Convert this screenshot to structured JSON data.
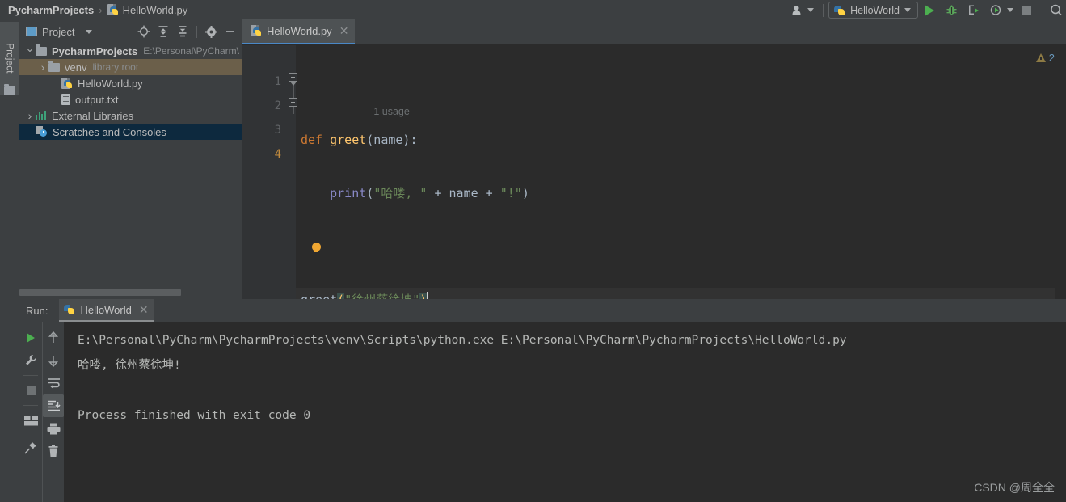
{
  "breadcrumb": {
    "project": "PycharmProjects",
    "separator": "›",
    "file": "HelloWorld.py",
    "file_icon": "python-file-icon"
  },
  "titlebar_right": {
    "profile_icon": "user-profile-icon",
    "run_config_name": "HelloWorld",
    "run_config_icon": "python-icon",
    "run_icon": "run-triangle-icon",
    "debug_icon": "debug-bug-icon",
    "coverage_icon": "run-with-coverage-icon",
    "profile_icon2": "profile-icon",
    "stop_icon": "stop-square-icon",
    "search_icon": "search-icon"
  },
  "left_strip": {
    "vertical_tab_label": "Project",
    "folder_icon": "folder-icon"
  },
  "project_panel": {
    "title": "Project",
    "title_icon": "project-window-icon",
    "dropdown_icon": "chevron-down-icon",
    "toolbar_icons": [
      "locate-target-icon",
      "expand-all-icon",
      "collapse-all-icon",
      "settings-gear-icon",
      "hide-minimize-icon"
    ],
    "tree": [
      {
        "label": "PycharmProjects",
        "sublabel": "E:\\Personal\\PyCharm\\",
        "icon": "folder-icon",
        "arrow": "expanded",
        "indent": 0,
        "state": "normal",
        "bold": true
      },
      {
        "label": "venv",
        "sublabel": "library root",
        "icon": "folder-icon",
        "arrow": "collapsed",
        "indent": 1,
        "state": "highlight-venv",
        "bold": false
      },
      {
        "label": "HelloWorld.py",
        "sublabel": "",
        "icon": "python-file-icon",
        "arrow": "none",
        "indent": 2,
        "state": "normal",
        "bold": false
      },
      {
        "label": "output.txt",
        "sublabel": "",
        "icon": "text-file-icon",
        "arrow": "none",
        "indent": 2,
        "state": "normal",
        "bold": false
      },
      {
        "label": "External Libraries",
        "sublabel": "",
        "icon": "library-icon",
        "arrow": "collapsed",
        "indent": 0,
        "state": "normal",
        "bold": false
      },
      {
        "label": "Scratches and Consoles",
        "sublabel": "",
        "icon": "scratches-icon",
        "arrow": "none",
        "indent": 0,
        "state": "selected",
        "bold": false
      }
    ]
  },
  "editor": {
    "tab_label": "HelloWorld.py",
    "tab_icon": "python-file-icon",
    "tab_close_icon": "close-icon",
    "inlay_hint": "1 usage",
    "warning_count": "2",
    "warning_icon": "warning-triangle-icon",
    "line_numbers": [
      "1",
      "2",
      "3",
      "4"
    ],
    "current_line": 4,
    "intention_bulb_icon": "lightbulb-icon",
    "code": {
      "line1_kw": "def",
      "line1_fn": "greet",
      "line1_rest": "(name):",
      "line2_fn": "print",
      "line2_open": "(",
      "line2_str1": "\"哈喽, \"",
      "line2_plus1": " + ",
      "line2_name": "name",
      "line2_plus2": " + ",
      "line2_str2": "\"!\"",
      "line2_close": ")",
      "line4_fn": "greet",
      "line4_open": "(",
      "line4_str": "\"徐州蔡徐坤\"",
      "line4_close": ")"
    }
  },
  "run_panel": {
    "label": "Run:",
    "tab_label": "HelloWorld",
    "tab_icon": "python-icon",
    "tab_close_icon": "close-icon",
    "tool_icons_left": [
      "rerun-green-triangle-icon",
      "wrench-settings-icon",
      "stop-square-icon",
      "layout-windows-icon",
      "pin-tab-icon"
    ],
    "tool_icons_right": [
      "arrow-up-icon",
      "arrow-down-icon",
      "soft-wrap-icon",
      "scroll-to-end-icon",
      "print-icon",
      "clear-all-trash-icon"
    ],
    "console_lines": [
      "E:\\Personal\\PyCharm\\PycharmProjects\\venv\\Scripts\\python.exe E:\\Personal\\PyCharm\\PycharmProjects\\HelloWorld.py",
      "哈喽, 徐州蔡徐坤!",
      "",
      "Process finished with exit code 0"
    ]
  },
  "watermark": "CSDN @周全全",
  "colors": {
    "window_bg": "#3c3f41",
    "editor_bg": "#2b2b2b",
    "gutter_bg": "#313335",
    "accent_blue": "#4a88c7",
    "selection_navy": "#0d293e",
    "highlight_tan": "#6b5f4a",
    "keyword_orange": "#cc7832",
    "function_yellow": "#ffc66d",
    "string_green": "#6a8759",
    "builtin_purple": "#8888c6",
    "text_default": "#a9b7c6",
    "run_green": "#4caf50"
  }
}
